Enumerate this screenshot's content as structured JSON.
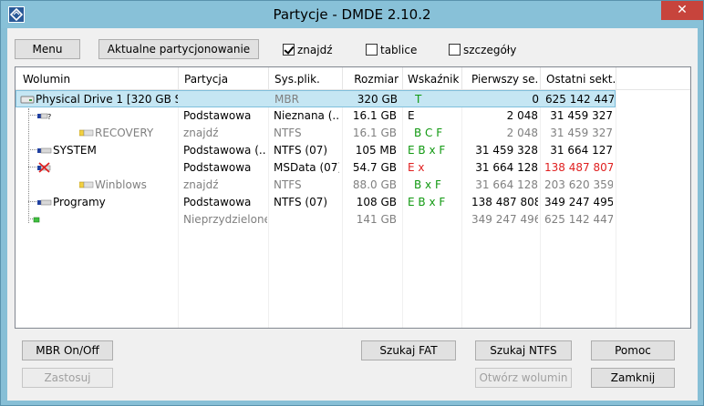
{
  "window": {
    "title": "Partycje - DMDE 2.10.2",
    "close_glyph": "✕"
  },
  "toolbar": {
    "menu_label": "Menu",
    "current_partitioning_label": "Aktualne partycjonowanie",
    "found": {
      "label": "znajdź",
      "checked": true
    },
    "tables": {
      "label": "tablice",
      "checked": false
    },
    "details": {
      "label": "szczegóły",
      "checked": false
    }
  },
  "columns": [
    "Wolumin",
    "Partycja",
    "Sys.plik.",
    "Rozmiar",
    "Wskaźniki",
    "Pierwszy se...",
    "Ostatni sekt..."
  ],
  "rows": [
    {
      "volume": "Physical Drive 1 [320 GB SA...",
      "partition": "",
      "fs": "MBR",
      "size": "320 GB",
      "flags": "T",
      "first": "0",
      "last": "625 142 447",
      "icon": "hard-drive-icon"
    },
    {
      "volume": "",
      "partition": "Podstawowa",
      "fs": "Nieznana (...",
      "size": "16.1 GB",
      "flags": "E",
      "first": "2 048",
      "last": "31 459 327",
      "icon": "unknown-partition-icon"
    },
    {
      "volume": "RECOVERY",
      "partition": "znajdź",
      "fs": "NTFS",
      "size": "16.1 GB",
      "flags": "B C F",
      "first": "2 048",
      "last": "31 459 327",
      "icon": "found-volume-icon"
    },
    {
      "volume": "SYSTEM",
      "partition": "Podstawowa (...",
      "fs": "NTFS (07)",
      "size": "105 MB",
      "flags": "E B x F",
      "first": "31 459 328",
      "last": "31 664 127",
      "icon": "partition-icon"
    },
    {
      "volume": "",
      "partition": "Podstawowa",
      "fs": "MSData (07)",
      "size": "54.7 GB",
      "flags": "E x",
      "first": "31 664 128",
      "last": "138 487 807",
      "icon": "broken-partition-icon"
    },
    {
      "volume": "Winblows",
      "partition": "znajdź",
      "fs": "NTFS",
      "size": "88.0 GB",
      "flags": "B x F",
      "first": "31 664 128",
      "last": "203 620 359",
      "icon": "found-volume-icon"
    },
    {
      "volume": "Programy",
      "partition": "Podstawowa",
      "fs": "NTFS (07)",
      "size": "108 GB",
      "flags": "E B x F",
      "first": "138 487 808",
      "last": "349 247 495",
      "icon": "partition-icon"
    },
    {
      "volume": "",
      "partition": "Nieprzydzielone",
      "fs": "",
      "size": "141 GB",
      "flags": "",
      "first": "349 247 496",
      "last": "625 142 447",
      "icon": "unallocated-icon"
    }
  ],
  "buttons": {
    "mbr_onoff": "MBR On/Off",
    "apply": "Zastosuj",
    "search_fat": "Szukaj FAT",
    "search_ntfs": "Szukaj NTFS",
    "open_volume": "Otwórz wolumin",
    "help": "Pomoc",
    "close": "Zamknij"
  },
  "colors": {
    "title_bar": "#88c1d8",
    "close_button": "#c7443c",
    "selected_row": "#c5e6f3",
    "flag_green": "#119911",
    "flag_red": "#e02020"
  }
}
